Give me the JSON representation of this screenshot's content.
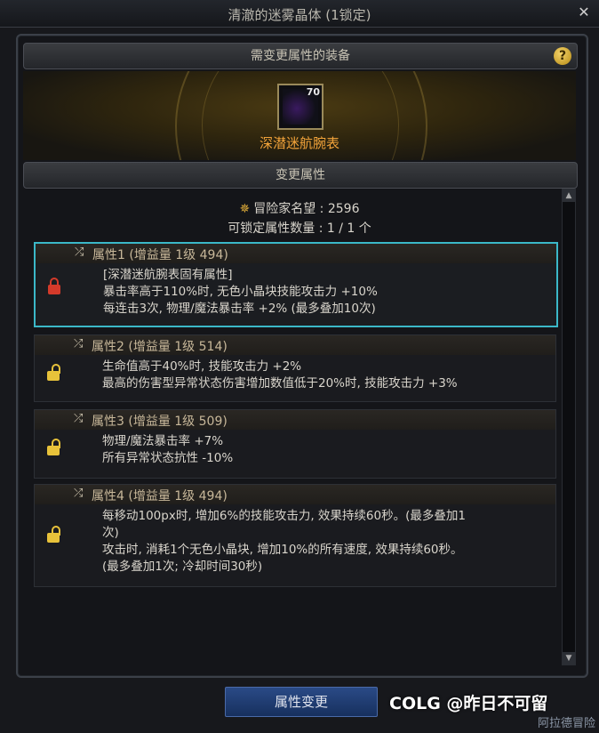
{
  "window": {
    "title": "清澈的迷雾晶体 (1锁定)"
  },
  "equipment_section": {
    "title": "需变更属性的装备",
    "help": "?"
  },
  "item": {
    "level": "70",
    "name": "深潜迷航腕表"
  },
  "change_section": {
    "title": "变更属性"
  },
  "reputation": {
    "label": "冒险家名望 : 2596"
  },
  "lock_count": {
    "label": "可锁定属性数量 :   1 / 1 个"
  },
  "attributes": [
    {
      "title": "属性1 (增益量 1级 494)",
      "locked": true,
      "lines": [
        "[深潜迷航腕表固有属性]",
        "暴击率高于110%时, 无色小晶块技能攻击力 +10%",
        "每连击3次, 物理/魔法暴击率 +2% (最多叠加10次)"
      ]
    },
    {
      "title": "属性2 (增益量 1级 514)",
      "locked": false,
      "lines": [
        "生命值高于40%时, 技能攻击力 +2%",
        "最高的伤害型异常状态伤害增加数值低于20%时, 技能攻击力 +3%"
      ]
    },
    {
      "title": "属性3 (增益量 1级 509)",
      "locked": false,
      "lines": [
        "物理/魔法暴击率 +7%",
        "所有异常状态抗性 -10%"
      ]
    },
    {
      "title": "属性4 (增益量 1级 494)",
      "locked": false,
      "lines": [
        "每移动100px时, 增加6%的技能攻击力, 效果持续60秒。(最多叠加1",
        "次)",
        "攻击时, 消耗1个无色小晶块, 增加10%的所有速度, 效果持续60秒。",
        "(最多叠加1次; 冷却时间30秒)"
      ]
    }
  ],
  "buttons": {
    "change": "属性变更"
  },
  "watermark": "COLG @昨日不可留",
  "corner_text": "阿拉德冒险",
  "colors": {
    "accent_selected": "#3bb8c8",
    "item_name": "#f2a33a",
    "lock_locked": "#d43a2a",
    "lock_unlocked": "#e8c23a"
  }
}
